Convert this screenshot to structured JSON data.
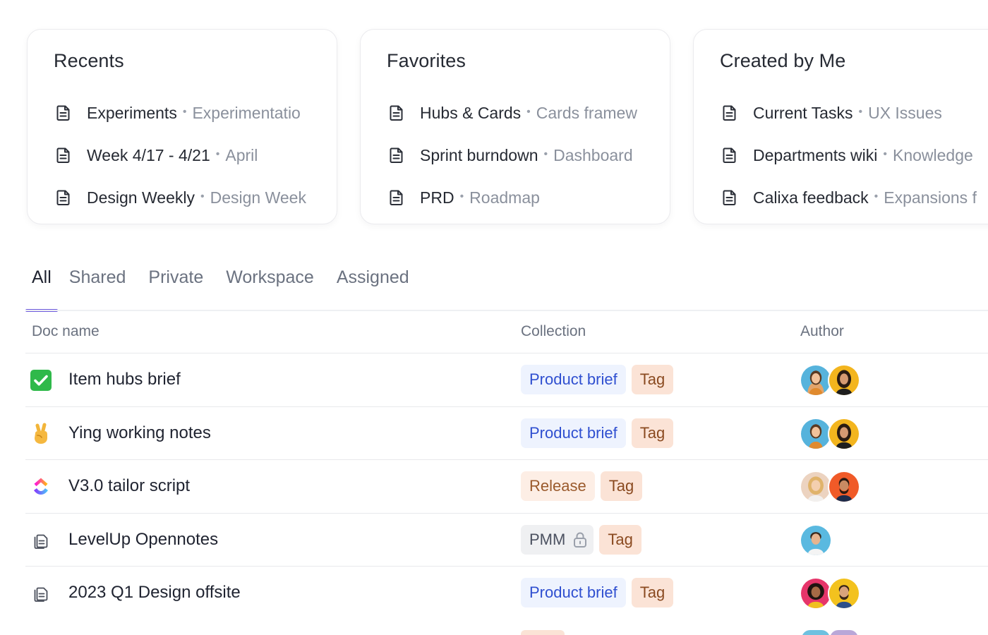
{
  "cards": [
    {
      "title": "Recents",
      "items": [
        {
          "name": "Experiments",
          "sub": "Experimentatio"
        },
        {
          "name": "Week 4/17 - 4/21",
          "sub": "April"
        },
        {
          "name": "Design Weekly",
          "sub": "Design Week"
        }
      ]
    },
    {
      "title": "Favorites",
      "items": [
        {
          "name": "Hubs & Cards",
          "sub": "Cards framew"
        },
        {
          "name": "Sprint burndown",
          "sub": "Dashboard"
        },
        {
          "name": "PRD",
          "sub": "Roadmap"
        }
      ]
    },
    {
      "title": "Created by Me",
      "items": [
        {
          "name": "Current Tasks",
          "sub": "UX Issues"
        },
        {
          "name": "Departments wiki",
          "sub": "Knowledge"
        },
        {
          "name": "Calixa feedback",
          "sub": "Expansions f"
        }
      ]
    }
  ],
  "tabs": [
    "All",
    "Shared",
    "Private",
    "Workspace",
    "Assigned"
  ],
  "active_tab": "All",
  "table": {
    "headers": {
      "doc_name": "Doc name",
      "collection": "Collection",
      "author": "Author"
    },
    "rows": [
      {
        "icon": "check-emoji-icon",
        "name": "Item hubs brief",
        "collection": "Product brief",
        "tag": "Tag"
      },
      {
        "icon": "victory-hand-emoji-icon",
        "name": "Ying working notes",
        "collection": "Product brief",
        "tag": "Tag"
      },
      {
        "icon": "clickup-logo-icon",
        "name": "V3.0 tailor script",
        "collection": "Release",
        "tag": "Tag"
      },
      {
        "icon": "documents-icon",
        "name": "LevelUp Opennotes",
        "collection": "PMM",
        "tag": "Tag"
      },
      {
        "icon": "documents-icon",
        "name": "2023 Q1 Design offsite",
        "collection": "Product brief",
        "tag": "Tag"
      }
    ]
  },
  "colors": {
    "accent": "#6e5bde",
    "pill_blue_bg": "#eef3fe",
    "pill_blue_text": "#2f4fd0",
    "tag_bg": "#fbe3d6",
    "tag_text": "#8a4a20"
  }
}
